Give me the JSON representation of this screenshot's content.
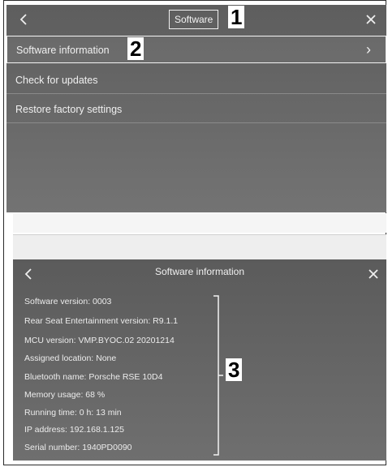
{
  "top_panel": {
    "back_icon": "chevron-left-icon",
    "close_icon": "close-icon",
    "title": "Software",
    "callout_1": "1",
    "callout_2": "2",
    "menu": [
      {
        "label": "Software information",
        "selected": true
      },
      {
        "label": "Check for updates",
        "selected": false
      },
      {
        "label": "Restore factory settings",
        "selected": false
      }
    ]
  },
  "bottom_panel": {
    "title": "Software information",
    "callout_3": "3",
    "info": [
      "Software version: 0003",
      "Rear Seat Entertainment version: R9.1.1",
      "MCU version: VMP.BYOC.02 20201214",
      "Assigned location: None",
      "Bluetooth name: Porsche RSE 10D4",
      "Memory usage: 68 %",
      "Running time: 0 h: 13 min",
      "IP address: 192.168.1.125",
      "Serial number: 1940PD0090"
    ]
  }
}
